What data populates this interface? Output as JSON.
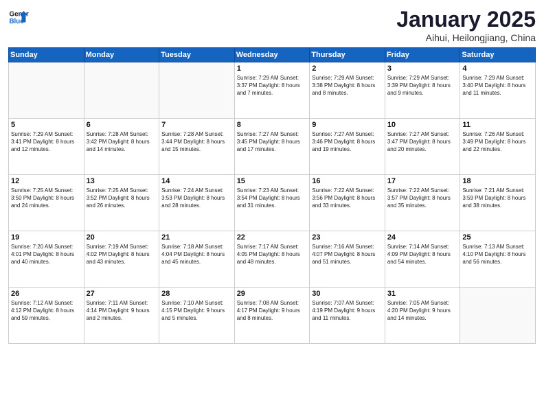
{
  "header": {
    "logo_line1": "General",
    "logo_line2": "Blue",
    "month": "January 2025",
    "location": "Aihui, Heilongjiang, China"
  },
  "days_of_week": [
    "Sunday",
    "Monday",
    "Tuesday",
    "Wednesday",
    "Thursday",
    "Friday",
    "Saturday"
  ],
  "weeks": [
    [
      {
        "day": "",
        "info": "",
        "empty": true
      },
      {
        "day": "",
        "info": "",
        "empty": true
      },
      {
        "day": "",
        "info": "",
        "empty": true
      },
      {
        "day": "1",
        "info": "Sunrise: 7:29 AM\nSunset: 3:37 PM\nDaylight: 8 hours\nand 7 minutes."
      },
      {
        "day": "2",
        "info": "Sunrise: 7:29 AM\nSunset: 3:38 PM\nDaylight: 8 hours\nand 8 minutes."
      },
      {
        "day": "3",
        "info": "Sunrise: 7:29 AM\nSunset: 3:39 PM\nDaylight: 8 hours\nand 9 minutes."
      },
      {
        "day": "4",
        "info": "Sunrise: 7:29 AM\nSunset: 3:40 PM\nDaylight: 8 hours\nand 11 minutes."
      }
    ],
    [
      {
        "day": "5",
        "info": "Sunrise: 7:29 AM\nSunset: 3:41 PM\nDaylight: 8 hours\nand 12 minutes."
      },
      {
        "day": "6",
        "info": "Sunrise: 7:28 AM\nSunset: 3:42 PM\nDaylight: 8 hours\nand 14 minutes."
      },
      {
        "day": "7",
        "info": "Sunrise: 7:28 AM\nSunset: 3:44 PM\nDaylight: 8 hours\nand 15 minutes."
      },
      {
        "day": "8",
        "info": "Sunrise: 7:27 AM\nSunset: 3:45 PM\nDaylight: 8 hours\nand 17 minutes."
      },
      {
        "day": "9",
        "info": "Sunrise: 7:27 AM\nSunset: 3:46 PM\nDaylight: 8 hours\nand 19 minutes."
      },
      {
        "day": "10",
        "info": "Sunrise: 7:27 AM\nSunset: 3:47 PM\nDaylight: 8 hours\nand 20 minutes."
      },
      {
        "day": "11",
        "info": "Sunrise: 7:26 AM\nSunset: 3:49 PM\nDaylight: 8 hours\nand 22 minutes."
      }
    ],
    [
      {
        "day": "12",
        "info": "Sunrise: 7:25 AM\nSunset: 3:50 PM\nDaylight: 8 hours\nand 24 minutes."
      },
      {
        "day": "13",
        "info": "Sunrise: 7:25 AM\nSunset: 3:52 PM\nDaylight: 8 hours\nand 26 minutes."
      },
      {
        "day": "14",
        "info": "Sunrise: 7:24 AM\nSunset: 3:53 PM\nDaylight: 8 hours\nand 28 minutes."
      },
      {
        "day": "15",
        "info": "Sunrise: 7:23 AM\nSunset: 3:54 PM\nDaylight: 8 hours\nand 31 minutes."
      },
      {
        "day": "16",
        "info": "Sunrise: 7:22 AM\nSunset: 3:56 PM\nDaylight: 8 hours\nand 33 minutes."
      },
      {
        "day": "17",
        "info": "Sunrise: 7:22 AM\nSunset: 3:57 PM\nDaylight: 8 hours\nand 35 minutes."
      },
      {
        "day": "18",
        "info": "Sunrise: 7:21 AM\nSunset: 3:59 PM\nDaylight: 8 hours\nand 38 minutes."
      }
    ],
    [
      {
        "day": "19",
        "info": "Sunrise: 7:20 AM\nSunset: 4:01 PM\nDaylight: 8 hours\nand 40 minutes."
      },
      {
        "day": "20",
        "info": "Sunrise: 7:19 AM\nSunset: 4:02 PM\nDaylight: 8 hours\nand 43 minutes."
      },
      {
        "day": "21",
        "info": "Sunrise: 7:18 AM\nSunset: 4:04 PM\nDaylight: 8 hours\nand 45 minutes."
      },
      {
        "day": "22",
        "info": "Sunrise: 7:17 AM\nSunset: 4:05 PM\nDaylight: 8 hours\nand 48 minutes."
      },
      {
        "day": "23",
        "info": "Sunrise: 7:16 AM\nSunset: 4:07 PM\nDaylight: 8 hours\nand 51 minutes."
      },
      {
        "day": "24",
        "info": "Sunrise: 7:14 AM\nSunset: 4:09 PM\nDaylight: 8 hours\nand 54 minutes."
      },
      {
        "day": "25",
        "info": "Sunrise: 7:13 AM\nSunset: 4:10 PM\nDaylight: 8 hours\nand 56 minutes."
      }
    ],
    [
      {
        "day": "26",
        "info": "Sunrise: 7:12 AM\nSunset: 4:12 PM\nDaylight: 8 hours\nand 59 minutes."
      },
      {
        "day": "27",
        "info": "Sunrise: 7:11 AM\nSunset: 4:14 PM\nDaylight: 9 hours\nand 2 minutes."
      },
      {
        "day": "28",
        "info": "Sunrise: 7:10 AM\nSunset: 4:15 PM\nDaylight: 9 hours\nand 5 minutes."
      },
      {
        "day": "29",
        "info": "Sunrise: 7:08 AM\nSunset: 4:17 PM\nDaylight: 9 hours\nand 8 minutes."
      },
      {
        "day": "30",
        "info": "Sunrise: 7:07 AM\nSunset: 4:19 PM\nDaylight: 9 hours\nand 11 minutes."
      },
      {
        "day": "31",
        "info": "Sunrise: 7:05 AM\nSunset: 4:20 PM\nDaylight: 9 hours\nand 14 minutes."
      },
      {
        "day": "",
        "info": "",
        "empty": true
      }
    ]
  ]
}
